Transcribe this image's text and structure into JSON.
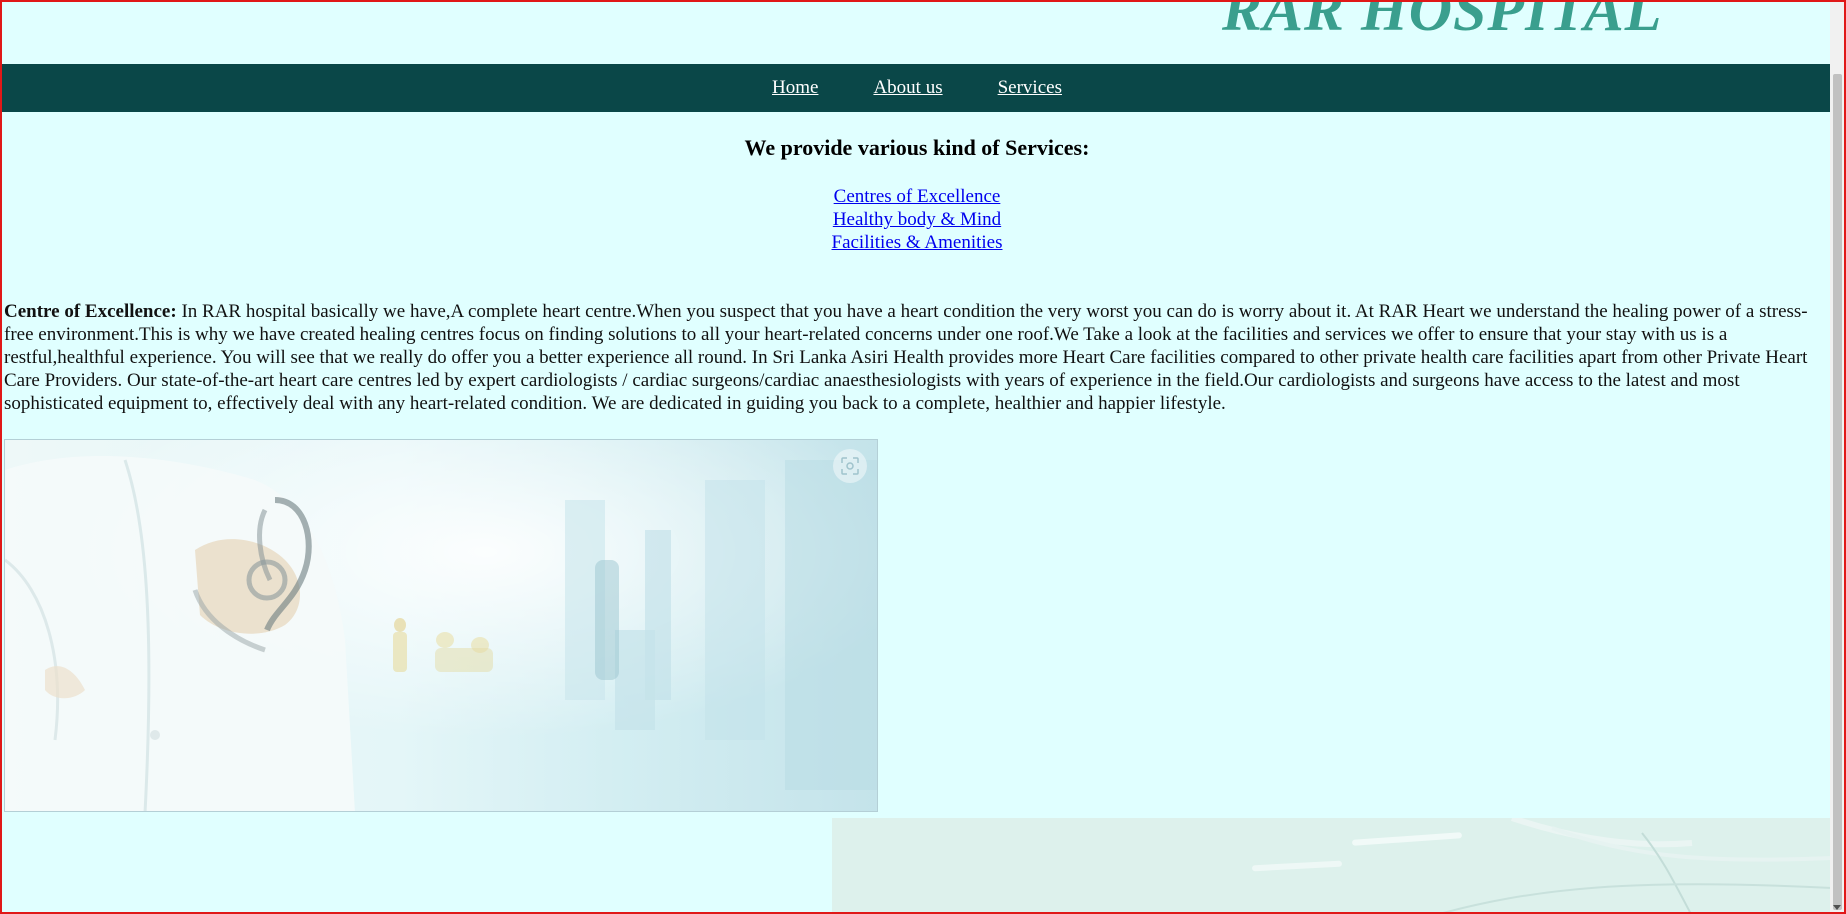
{
  "site": {
    "title": "RAR HOSPITAL"
  },
  "nav": {
    "items": [
      {
        "label": "Home"
      },
      {
        "label": "About us"
      },
      {
        "label": "Services"
      }
    ]
  },
  "services": {
    "heading": "We provide various kind of Services:",
    "links": [
      {
        "label": "Centres of Excellence"
      },
      {
        "label": "Healthy body & Mind"
      },
      {
        "label": "Facilities & Amenities"
      }
    ]
  },
  "content": {
    "lead": "Centre of Excellence:",
    "body": " In RAR hospital basically we have,A complete heart centre.When you suspect that you have a heart condition the very worst you can do is worry about it. At RAR Heart we understand the healing power of a stress-free environment.This is why we have created healing centres focus on finding solutions to all your heart-related concerns under one roof.We Take a look at the facilities and services we offer to ensure that your stay with us is a restful,healthful experience. You will see that we really do offer you a better experience all round. In Sri Lanka Asiri Health provides more Heart Care facilities compared to other private health care facilities apart from other Private Heart Care Providers. Our state-of-the-art heart care centres led by expert cardiologists / cardiac surgeons/cardiac anaesthesiologists with years of experience in the field.Our cardiologists and surgeons have access to the latest and most sophisticated equipment to, effectively deal with any heart-related condition. We are dedicated in guiding you back to a complete, healthier and happier lifestyle."
  },
  "images": {
    "photo_one_icon": "image-search-icon",
    "photo_one_subject": "doctor-with-stethoscope-hospital-corridor",
    "photo_two_subject": "hospital-ceiling-interior"
  },
  "colors": {
    "page_background": "#e0ffff",
    "nav_background": "#0a4748",
    "title_color": "#3a9f8e",
    "link_color": "#0000ee",
    "frame_border": "#e01818"
  }
}
